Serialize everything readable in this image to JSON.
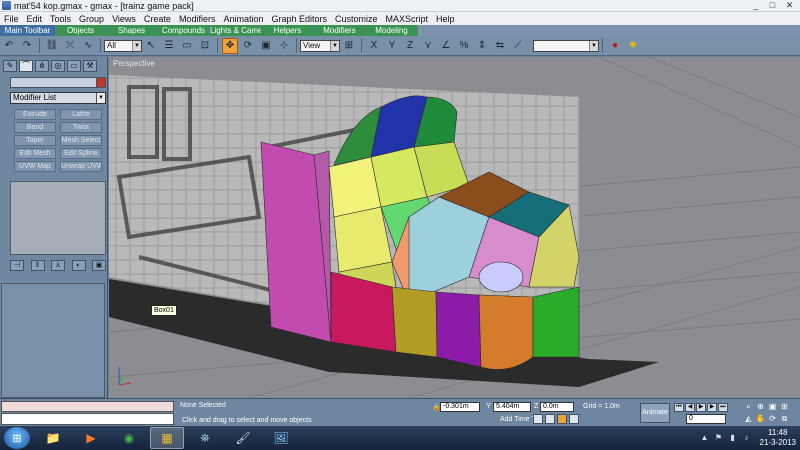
{
  "window": {
    "title": "mat'54 kop.gmax - gmax - [trainz game pack]",
    "controls": [
      "_",
      "□",
      "✕"
    ]
  },
  "menubar": [
    "File",
    "Edit",
    "Tools",
    "Group",
    "Views",
    "Create",
    "Modifiers",
    "Animation",
    "Graph Editors",
    "Customize",
    "MAXScript",
    "Help"
  ],
  "tabs": [
    "Main Toolbar",
    "Objects",
    "Shapes",
    "Compounds",
    "Lights & Cameras",
    "Helpers",
    "Modifiers",
    "Modeling"
  ],
  "toolbar": {
    "selection_filter": "All",
    "ref_coord": "View",
    "named_selection": ""
  },
  "command_panel": {
    "modifier_list": "Modifier List",
    "modifier_buttons": [
      "Extrude",
      "Lathe",
      "Bend",
      "Twist",
      "Taper",
      "Mesh Select",
      "Edit Mesh",
      "Edit Spline",
      "UVW Map",
      "Unwrap UVW"
    ],
    "stack_buttons": [
      "⊣",
      "‖",
      "⅄",
      "◐",
      "▣"
    ]
  },
  "viewport": {
    "label": "Perspective",
    "tooltip": "Box01",
    "axis_labels": [
      "x",
      "y",
      "z"
    ]
  },
  "status": {
    "selection": "None Selected",
    "prompt": "Click and drag to select and move objects",
    "x_label": "X",
    "x_value": "-0.301m",
    "y_label": "Y",
    "y_value": "5.404m",
    "z_label": "Z",
    "z_value": "0.0m",
    "grid": "Grid = 1.0m",
    "add_time_tag": "Add Time Tag",
    "animate": "Animate",
    "frame": "0"
  },
  "taskbar": {
    "time": "11:48",
    "date": "21-3-2013"
  },
  "colors": {
    "toolbar": "#7890a8",
    "active_tool": "#f0a23a",
    "panel": "#6f87a1"
  }
}
